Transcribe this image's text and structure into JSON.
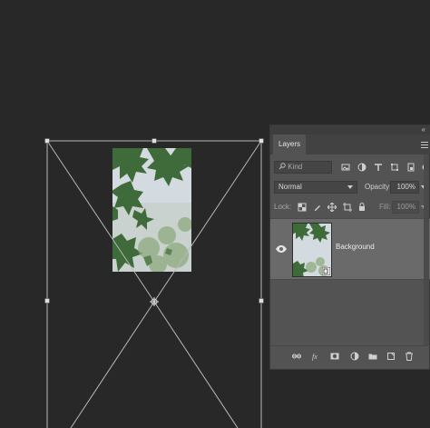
{
  "panel": {
    "tab_label": "Layers",
    "collapse_label": "«"
  },
  "filter": {
    "placeholder": "Kind",
    "selected": "Kind"
  },
  "blend": {
    "mode": "Normal",
    "opacity_label": "Opacity:",
    "opacity_value": "100%"
  },
  "lock": {
    "label": "Lock:",
    "fill_label": "Fill:",
    "fill_value": "100%"
  },
  "layers": [
    {
      "name": "Background",
      "visible": true
    }
  ],
  "colors": {
    "canvas_bg": "#282828",
    "panel_bg": "#535353",
    "selected_layer_bg": "#6a6a6a",
    "transform_line": "#b8b8b8"
  },
  "icons": {
    "filter": [
      "image-filter-icon",
      "adjustment-filter-icon",
      "type-filter-icon",
      "shape-filter-icon",
      "smart-object-filter-icon",
      "filter-toggle-icon"
    ],
    "lock": [
      "lock-transparent-pixels-icon",
      "lock-image-pixels-icon",
      "lock-position-icon",
      "lock-artboard-icon",
      "lock-all-icon"
    ],
    "footer": [
      "link-layers-icon",
      "fx-icon",
      "layer-mask-icon",
      "adjustment-layer-icon",
      "group-folder-icon",
      "new-layer-icon",
      "trash-icon"
    ]
  }
}
